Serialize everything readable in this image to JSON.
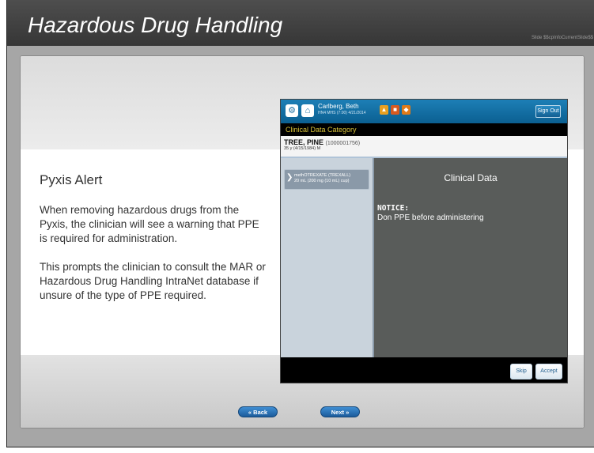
{
  "header": {
    "title": "Hazardous Drug Handling",
    "slide_info": "Slide $$cpInfoCurrentSlide$$"
  },
  "slide": {
    "heading": "Pyxis Alert",
    "paragraphs": [
      "When removing hazardous drugs from the Pyxis, the clinician will see a warning that PPE is required for administration.",
      "This prompts the clinician to consult the MAR or Hazardous Drug Handling IntraNet database if unsure of the type of PPE required."
    ]
  },
  "device": {
    "user_name": "Carlberg, Beth",
    "user_sub": "HN4 MHS (7:00) 4/21/2014",
    "sign_out": "Sign Out",
    "category": "Clinical Data Category",
    "patient_name": "TREE, PINE",
    "patient_id": "(1000001756)",
    "patient_sub": "35 y (4/15/1984) M",
    "item_line1": "methOTREXATE (TREXALL)",
    "item_line2": "20 mL (200 mg (10 mL) cup)",
    "panel_title": "Clinical Data",
    "notice_label": "NOTICE:",
    "notice_message": "Don PPE before administering",
    "skip": "Skip",
    "accept": "Accept"
  },
  "nav": {
    "back": "« Back",
    "next": "Next »"
  },
  "colors": {
    "header_bg": "#3d3d3d",
    "device_bar": "#1273ab",
    "nav_button": "#2b74b8"
  }
}
